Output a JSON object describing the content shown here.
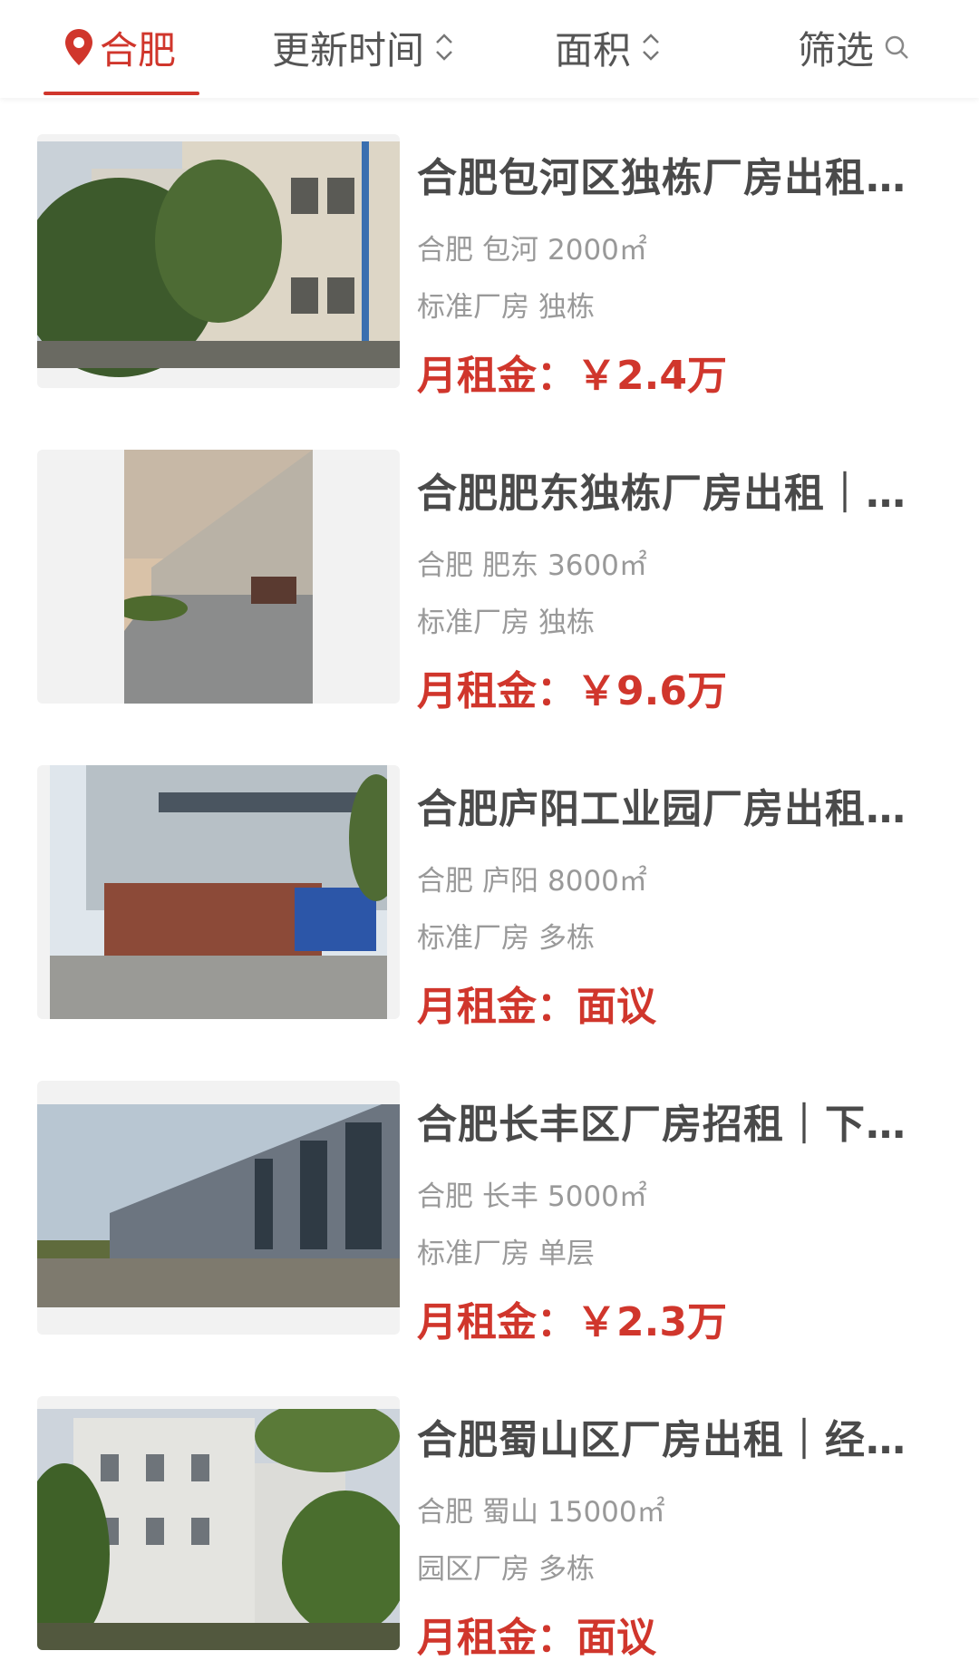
{
  "filter_bar": {
    "city": "合肥",
    "sort_time": "更新时间",
    "sort_area": "面积",
    "filter": "筛选",
    "accent_color": "#d0362c"
  },
  "listings": [
    {
      "title": "合肥包河区独栋厂房出租…",
      "city": "合肥",
      "district": "包河",
      "area": "2000㎡",
      "type": "标准厂房",
      "layout": "独栋",
      "price_label": "月租金：",
      "price": "￥2.4万"
    },
    {
      "title": "合肥肥东独栋厂房出租｜…",
      "city": "合肥",
      "district": "肥东",
      "area": "3600㎡",
      "type": "标准厂房",
      "layout": "独栋",
      "price_label": "月租金：",
      "price": "￥9.6万"
    },
    {
      "title": "合肥庐阳工业园厂房出租…",
      "city": "合肥",
      "district": "庐阳",
      "area": "8000㎡",
      "type": "标准厂房",
      "layout": "多栋",
      "price_label": "月租金：",
      "price": "面议"
    },
    {
      "title": "合肥长丰区厂房招租｜下…",
      "city": "合肥",
      "district": "长丰",
      "area": "5000㎡",
      "type": "标准厂房",
      "layout": "单层",
      "price_label": "月租金：",
      "price": "￥2.3万"
    },
    {
      "title": "合肥蜀山区厂房出租｜经…",
      "city": "合肥",
      "district": "蜀山",
      "area": "15000㎡",
      "type": "园区厂房",
      "layout": "多栋",
      "price_label": "月租金：",
      "price": "面议"
    }
  ]
}
